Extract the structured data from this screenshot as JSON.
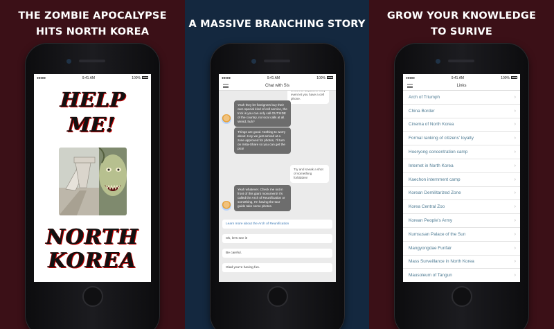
{
  "panels": [
    {
      "headline_line1": "THE ZOMBIE APOCALYPSE",
      "headline_line2": "HITS NORTH KOREA",
      "status": {
        "signal": "●●●●●",
        "carrier": "",
        "time": "9:41 AM",
        "battery": "100%"
      },
      "title_top": "HELP ME!",
      "title_bottom_line1": "NORTH",
      "title_bottom_line2": "KOREA"
    },
    {
      "headline": "A MASSIVE BRANCHING STORY",
      "status": {
        "signal": "●●●●●",
        "time": "9:41 AM",
        "battery": "100%"
      },
      "nav_title": "Chat with Sis",
      "messages": [
        {
          "text": "to tell me anywhere they even let you have a cell phone."
        },
        {
          "text": "Yeah they let foreigners buy their own special kind of cell service, the trick is you can only call OUTSIDE of the country, no local calls at all. Weird, huh?"
        },
        {
          "text": "Things are good. Nothing to worry about. Hey we just arrived at a zone approved for photos, I'll turn on Insta-Share so you can get the pics!"
        },
        {
          "text": "Try and sneak a shot of something forbidden!"
        },
        {
          "text": "Yeah whatever. Check me out in front of this giant monument! It's called the Arch of Reunification or something, I'm having the tour guide take some photos."
        }
      ],
      "link_text": "Learn more about the Arch of Reunification",
      "choices": [
        "Ok, let's see it!",
        "Be careful.",
        "Glad you're having fun."
      ]
    },
    {
      "headline_line1": "GROW YOUR KNOWLEDGE",
      "headline_line2": "TO SURIVE",
      "status": {
        "signal": "●●●●●",
        "time": "9:41 AM",
        "battery": "100%"
      },
      "nav_title": "Links",
      "items": [
        "Arch of Triumph",
        "China Border",
        "Cinema of North Korea",
        "Formal ranking of citizens' loyalty",
        "Hoeryong concentration camp",
        "Internet in North Korea",
        "Kaechon internment camp",
        "Korean Demilitarized Zone",
        "Korea Central Zoo",
        "Korean People's Army",
        "Kumsusan Palace of the Sun",
        "Mangyongdae Funfair",
        "Mass Surveillance in North Korea",
        "Mausoleum of Tangun"
      ],
      "chevron": "›"
    }
  ]
}
